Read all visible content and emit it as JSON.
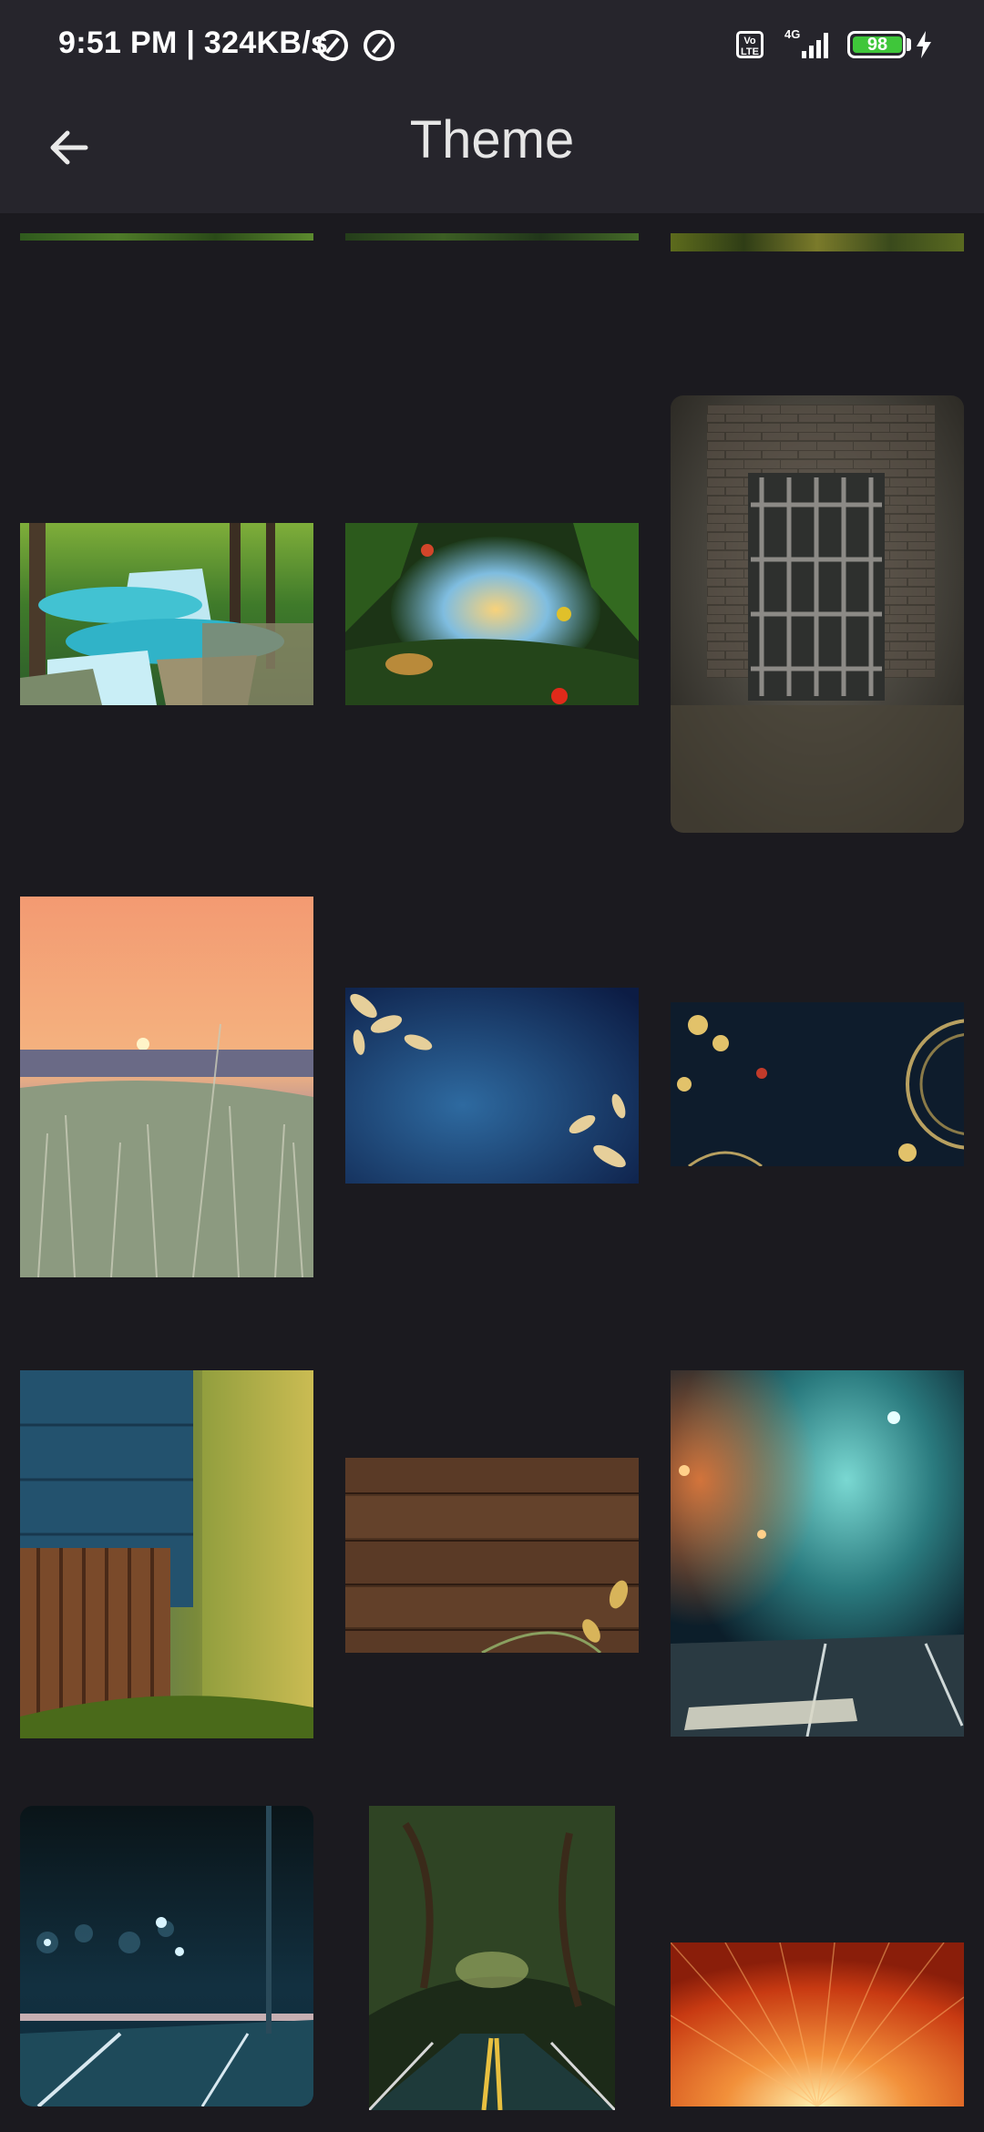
{
  "status_bar": {
    "time": "9:51 PM | 324KB/s",
    "volte": "Vo LTE",
    "network": "4G",
    "battery": "98"
  },
  "app_bar": {
    "back_icon": "arrow-left-icon",
    "title": "Theme"
  },
  "themes": [
    {
      "name": "forest-strip-1"
    },
    {
      "name": "forest-strip-2"
    },
    {
      "name": "forest-strip-3"
    },
    {
      "name": "waterfall"
    },
    {
      "name": "jungle-portal"
    },
    {
      "name": "brick-window"
    },
    {
      "name": "sunset-field"
    },
    {
      "name": "blue-gold-leaves"
    },
    {
      "name": "navy-gold-floral"
    },
    {
      "name": "blue-wooden-house"
    },
    {
      "name": "wood-planks"
    },
    {
      "name": "foggy-street-stop"
    },
    {
      "name": "night-city-road"
    },
    {
      "name": "forest-road"
    },
    {
      "name": "orange-sunburst"
    }
  ]
}
